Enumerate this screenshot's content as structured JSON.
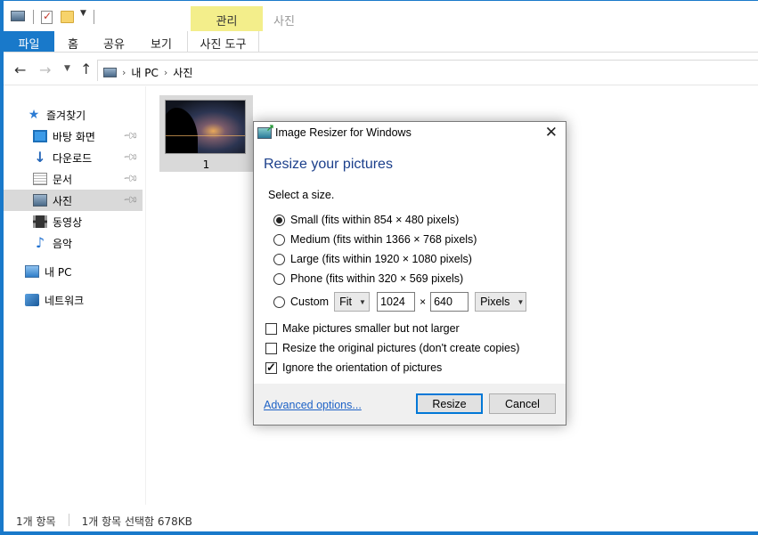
{
  "ribbon": {
    "context_tab": "관리",
    "context_title": "사진",
    "tabs": [
      "파일",
      "홈",
      "공유",
      "보기",
      "사진 도구"
    ]
  },
  "breadcrumb": [
    "내 PC",
    "사진"
  ],
  "sidebar": {
    "quick_access": "즐겨찾기",
    "items": [
      {
        "label": "바탕 화면",
        "icon": "desktop-icon",
        "pinned": true
      },
      {
        "label": "다운로드",
        "icon": "download-icon",
        "pinned": true
      },
      {
        "label": "문서",
        "icon": "document-icon",
        "pinned": true
      },
      {
        "label": "사진",
        "icon": "pictures-icon",
        "pinned": true,
        "selected": true
      },
      {
        "label": "동영상",
        "icon": "video-icon",
        "pinned": false
      },
      {
        "label": "음악",
        "icon": "music-icon",
        "pinned": false
      }
    ],
    "this_pc": "내 PC",
    "network": "네트워크"
  },
  "files": [
    {
      "label": "1",
      "selected": true
    }
  ],
  "status": {
    "count": "1개 항목",
    "selection": "1개 항목 선택함 678KB"
  },
  "dialog": {
    "title": "Image Resizer for Windows",
    "heading": "Resize your pictures",
    "prompt": "Select a size.",
    "sizes": [
      {
        "label": "Small (fits within 854 × 480 pixels)",
        "checked": true
      },
      {
        "label": "Medium (fits within 1366 × 768 pixels)",
        "checked": false
      },
      {
        "label": "Large (fits within 1920 × 1080 pixels)",
        "checked": false
      },
      {
        "label": "Phone (fits within 320 × 569 pixels)",
        "checked": false
      }
    ],
    "custom": {
      "label": "Custom",
      "fit": "Fit",
      "width": "1024",
      "times": "×",
      "height": "640",
      "unit": "Pixels"
    },
    "options": [
      {
        "label": "Make pictures smaller but not larger",
        "checked": false
      },
      {
        "label": "Resize the original pictures (don't create copies)",
        "checked": false
      },
      {
        "label": "Ignore the orientation of pictures",
        "checked": true
      }
    ],
    "advanced": "Advanced options...",
    "resize": "Resize",
    "cancel": "Cancel"
  },
  "colors": {
    "accent": "#1979ca",
    "context_tab": "#f3ee8b",
    "heading": "#1b3f8b",
    "link": "#1d62c6"
  }
}
